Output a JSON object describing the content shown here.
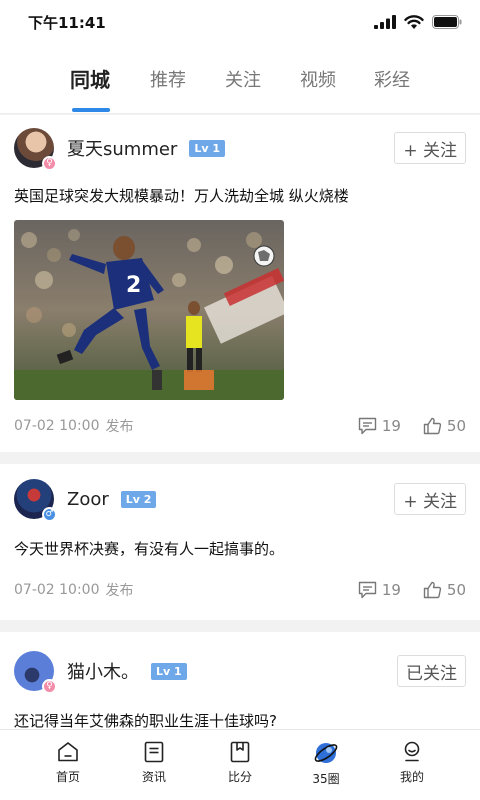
{
  "status_bar": {
    "time": "下午11:41"
  },
  "tabs": [
    {
      "label": "同城",
      "active": true
    },
    {
      "label": "推荐",
      "active": false
    },
    {
      "label": "关注",
      "active": false
    },
    {
      "label": "视频",
      "active": false
    },
    {
      "label": "彩经",
      "active": false
    }
  ],
  "posts": [
    {
      "username": "夏天summer",
      "level": "Lv 1",
      "gender": "female",
      "follow_label": "+ 关注",
      "text": "英国足球突发大规模暴动！万人洗劫全城 纵火烧楼",
      "has_image": true,
      "image_alt": "Soccer player in blue jersey number 2 kicking the ball",
      "time": "07-02 10:00",
      "publish_label": "发布",
      "comments": "19",
      "likes": "50"
    },
    {
      "username": "Zoor",
      "level": "Lv 2",
      "gender": "male",
      "follow_label": "+ 关注",
      "text": "今天世界杯决赛，有没有人一起搞事的。",
      "has_image": false,
      "time": "07-02 10:00",
      "publish_label": "发布",
      "comments": "19",
      "likes": "50"
    },
    {
      "username": "猫小木。",
      "level": "Lv 1",
      "gender": "female",
      "follow_label": "已关注",
      "text": "还记得当年艾佛森的职业生涯十佳球吗?"
    }
  ],
  "bottom_nav": [
    {
      "label": "首页",
      "icon": "home-icon"
    },
    {
      "label": "资讯",
      "icon": "news-icon"
    },
    {
      "label": "比分",
      "icon": "score-icon"
    },
    {
      "label": "35圈",
      "icon": "planet-icon"
    },
    {
      "label": "我的",
      "icon": "profile-icon"
    }
  ],
  "colors": {
    "accent": "#2e88e8",
    "level_badge": "#6ea8e8",
    "female": "#f28ca8",
    "male": "#4a90e2"
  }
}
